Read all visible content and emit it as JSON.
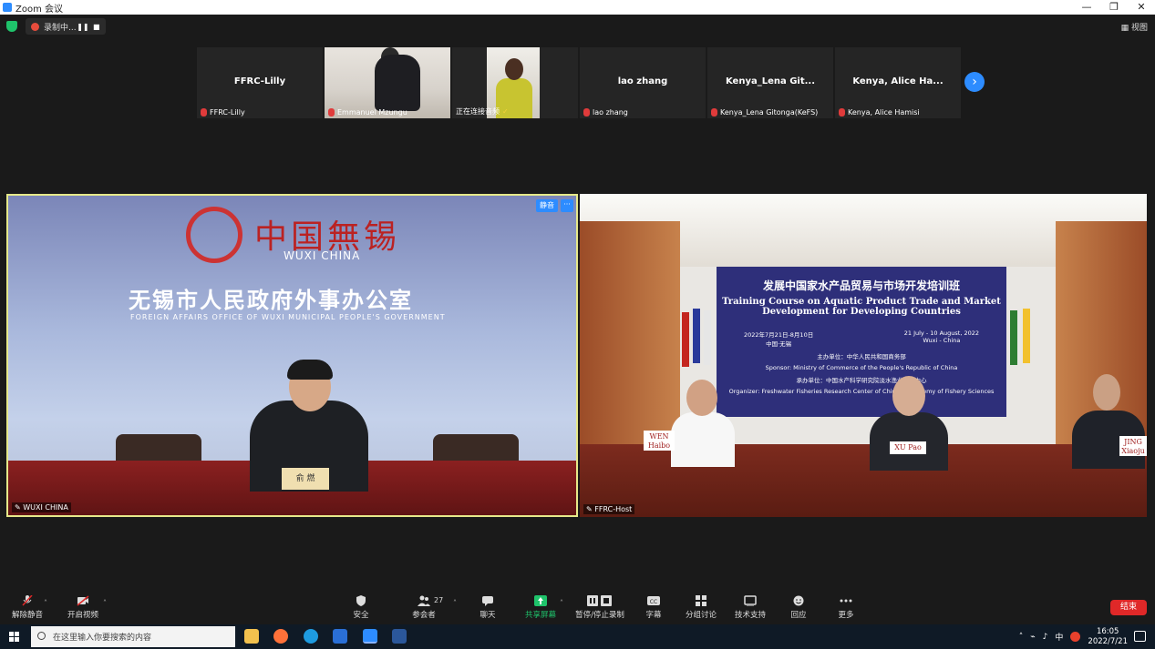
{
  "window": {
    "title": "Zoom 会议",
    "controls": [
      "—",
      "❐",
      "✕"
    ]
  },
  "meeting_bar": {
    "recording_label": "录制中...",
    "view_label": "视图"
  },
  "participants": [
    {
      "display_name": "FFRC-Lilly",
      "label": "FFRC-Lilly",
      "has_video": false
    },
    {
      "display_name": "",
      "label": "Emmanuel Mzungu",
      "has_video": true
    },
    {
      "display_name": "",
      "label": "正在连接音频",
      "has_video": true
    },
    {
      "display_name": "lao zhang",
      "label": "lao zhang",
      "has_video": false
    },
    {
      "display_name": "Kenya_Lena Git...",
      "label": "Kenya_Lena Gitonga(KeFS)",
      "has_video": false
    },
    {
      "display_name": "Kenya, Alice Ha...",
      "label": "Kenya, Alice Hamisi",
      "has_video": false
    }
  ],
  "main_left": {
    "mute_label": "静音",
    "more_label": "···",
    "logo_cn": "中国無锡",
    "logo_en": "WUXI CHINA",
    "office_cn": "无锡市人民政府外事办公室",
    "office_en": "FOREIGN AFFAIRS OFFICE OF WUXI MUNICIPAL PEOPLE'S GOVERNMENT",
    "nameplate": "俞 燃",
    "label": "WUXI CHINA"
  },
  "main_right": {
    "banner": {
      "title_cn": "发展中国家水产品贸易与市场开发培训班",
      "title_en_1": "Training Course on Aquatic Product Trade and Market",
      "title_en_2": "Development for Developing Countries",
      "date_cn": "2022年7月21日-8月10日",
      "place_cn": "中国·无锡",
      "date_en": "21 July - 10 August, 2022",
      "place_en": "Wuxi - China",
      "sponsor_cn": "主办单位：中华人民共和国商务部",
      "sponsor_en": "Sponsor: Ministry of Commerce of the People's Republic of China",
      "organizer_cn": "承办单位：中国水产科学研究院淡水渔业研究中心",
      "organizer_en": "Organizer: Freshwater Fisheries Research Center of Chinese Academy of Fishery Sciences"
    },
    "nameplates": [
      "WEN Haibo",
      "XU Pao",
      "JING Xiaoju"
    ],
    "label": "FFRC-Host"
  },
  "toolbar": {
    "items": [
      {
        "label": "解除静音",
        "icon": "mic-off-icon"
      },
      {
        "label": "开启视频",
        "icon": "video-off-icon"
      },
      {
        "label": "安全",
        "icon": "shield-icon"
      },
      {
        "label": "参会者",
        "icon": "participants-icon",
        "count": "27"
      },
      {
        "label": "聊天",
        "icon": "chat-icon"
      },
      {
        "label": "共享屏幕",
        "icon": "share-screen-icon"
      },
      {
        "label": "暂停/停止录制",
        "icon": "record-icon"
      },
      {
        "label": "字幕",
        "icon": "cc-icon"
      },
      {
        "label": "分组讨论",
        "icon": "breakout-icon"
      },
      {
        "label": "技术支持",
        "icon": "support-icon"
      },
      {
        "label": "回应",
        "icon": "reaction-icon"
      },
      {
        "label": "更多",
        "icon": "more-icon"
      }
    ],
    "end_label": "结束"
  },
  "taskbar": {
    "search_placeholder": "在这里输入你要搜索的内容",
    "ime": "中",
    "time": "16:05",
    "date": "2022/7/21"
  },
  "colors": {
    "accent": "#2d8cff",
    "end": "#e02828",
    "share": "#1fc36b",
    "active_border": "#e6e98a"
  }
}
